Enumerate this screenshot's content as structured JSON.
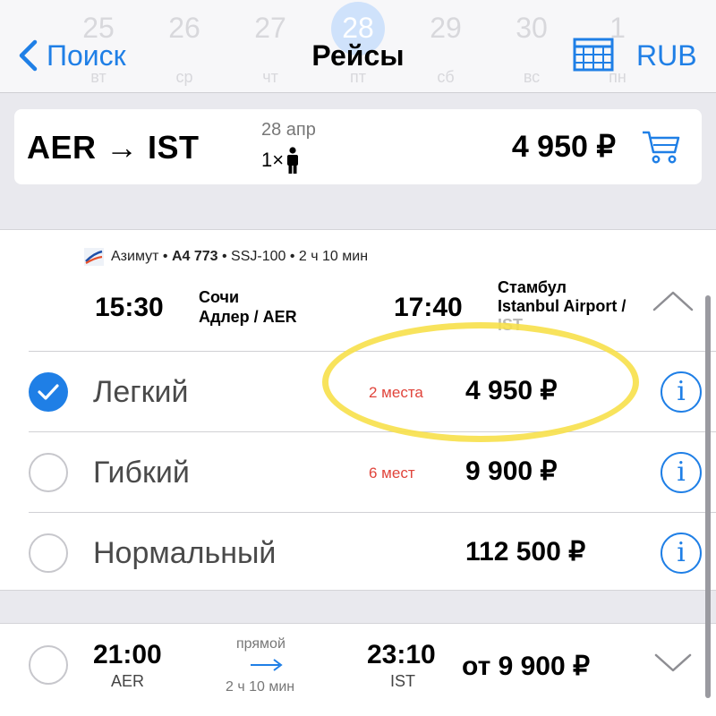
{
  "nav": {
    "back_label": "Поиск",
    "title": "Рейсы",
    "currency": "RUB",
    "dates": [
      {
        "num": "25",
        "dow": "вт"
      },
      {
        "num": "26",
        "dow": "ср"
      },
      {
        "num": "27",
        "dow": "чт"
      },
      {
        "num": "28",
        "dow": "пт"
      },
      {
        "num": "29",
        "dow": "сб"
      },
      {
        "num": "30",
        "dow": "вс"
      },
      {
        "num": "1",
        "dow": "пн"
      }
    ]
  },
  "summary": {
    "route": "AER → IST",
    "date": "28 апр",
    "pax": "1×",
    "price": "4 950 ₽"
  },
  "flight": {
    "airline": "Азимут",
    "flight_no": "A4 773",
    "aircraft_duration": "SSJ-100 • 2 ч 10 мин",
    "dep_time": "15:30",
    "dep_city": "Сочи",
    "dep_airport": "Адлер / AER",
    "arr_time": "17:40",
    "arr_city": "Стамбул",
    "arr_airport": "Istanbul Airport /",
    "arr_code": "IST",
    "fares": [
      {
        "name": "Легкий",
        "seats": "2 места",
        "price": "4 950 ₽",
        "selected": true
      },
      {
        "name": "Гибкий",
        "seats": "6 мест",
        "price": "9 900 ₽",
        "selected": false
      },
      {
        "name": "Нормальный",
        "seats": "",
        "price": "112 500 ₽",
        "selected": false
      }
    ]
  },
  "next_flight": {
    "dep_time": "21:00",
    "dep_code": "AER",
    "type": "прямой",
    "duration": "2 ч 10 мин",
    "arr_time": "23:10",
    "arr_code": "IST",
    "price": "от 9 900 ₽"
  },
  "colors": {
    "accent": "#1f7fe6",
    "seats_warning": "#e0443b",
    "highlight": "#f7e04a"
  }
}
